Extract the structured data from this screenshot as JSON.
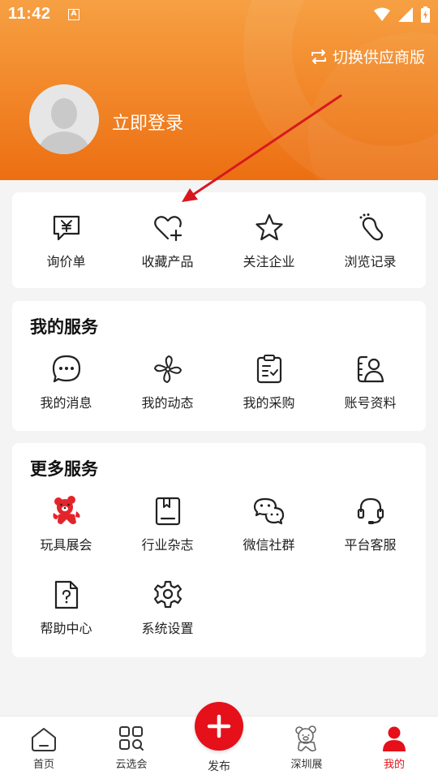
{
  "status_bar": {
    "time": "11:42",
    "notification_badge": "A"
  },
  "header": {
    "switch_supplier_label": "切换供应商版",
    "login_label": "立即登录"
  },
  "quick_actions": [
    {
      "label": "询价单",
      "icon": "inquiry-yen-icon"
    },
    {
      "label": "收藏产品",
      "icon": "heart-plus-icon"
    },
    {
      "label": "关注企业",
      "icon": "star-icon"
    },
    {
      "label": "浏览记录",
      "icon": "footprint-icon"
    }
  ],
  "my_services": {
    "title": "我的服务",
    "items": [
      {
        "label": "我的消息",
        "icon": "chat-bubble-icon"
      },
      {
        "label": "我的动态",
        "icon": "pinwheel-icon"
      },
      {
        "label": "我的采购",
        "icon": "clipboard-icon"
      },
      {
        "label": "账号资料",
        "icon": "profile-card-icon"
      }
    ]
  },
  "more_services": {
    "title": "更多服务",
    "items": [
      {
        "label": "玩具展会",
        "icon": "toy-bear-icon"
      },
      {
        "label": "行业杂志",
        "icon": "magazine-icon"
      },
      {
        "label": "微信社群",
        "icon": "wechat-icon"
      },
      {
        "label": "平台客服",
        "icon": "headset-icon"
      },
      {
        "label": "帮助中心",
        "icon": "help-document-icon"
      },
      {
        "label": "系统设置",
        "icon": "gear-icon"
      }
    ]
  },
  "bottom_nav": {
    "items": [
      {
        "label": "首页",
        "icon": "home-icon"
      },
      {
        "label": "云选会",
        "icon": "grid-search-icon"
      },
      {
        "label": "发布",
        "icon": "plus-icon"
      },
      {
        "label": "深圳展",
        "icon": "bear-icon"
      },
      {
        "label": "我的",
        "icon": "user-icon"
      }
    ],
    "active": "我的"
  },
  "colors": {
    "header_orange": "#f28a2c",
    "accent_red": "#e5101a",
    "annotation_arrow": "#d7191f"
  }
}
